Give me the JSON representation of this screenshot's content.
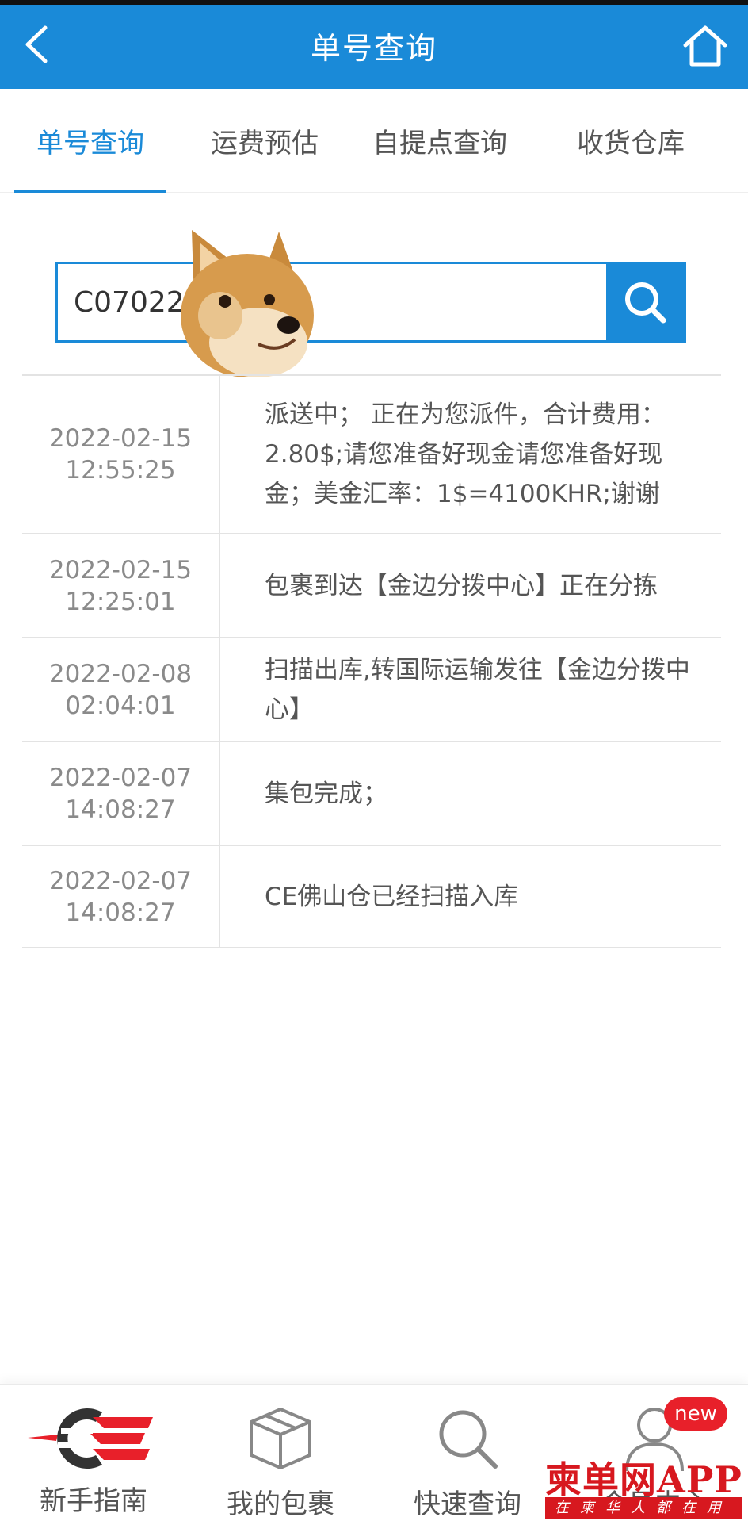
{
  "header": {
    "title": "单号查询"
  },
  "tabs": [
    {
      "label": "单号查询",
      "active": true
    },
    {
      "label": "运费预估",
      "active": false
    },
    {
      "label": "自提点查询",
      "active": false
    },
    {
      "label": "收货仓库",
      "active": false
    }
  ],
  "search": {
    "value": "C07022"
  },
  "timeline": [
    {
      "date": "2022-02-15",
      "time": "12:55:25",
      "text": "派送中； 正在为您派件，合计费用：2.80$;请您准备好现金请您准备好现金；美金汇率：1$=4100KHR;谢谢"
    },
    {
      "date": "2022-02-15",
      "time": "12:25:01",
      "text": "包裹到达【金边分拨中心】正在分拣"
    },
    {
      "date": "2022-02-08",
      "time": "02:04:01",
      "text": "扫描出库,转国际运输发往【金边分拨中心】"
    },
    {
      "date": "2022-02-07",
      "time": "14:08:27",
      "text": "集包完成；"
    },
    {
      "date": "2022-02-07",
      "time": "14:08:27",
      "text": "CE佛山仓已经扫描入库"
    }
  ],
  "bottom_nav": [
    {
      "label": "新手指南",
      "icon": "ce-logo-icon"
    },
    {
      "label": "我的包裹",
      "icon": "package-icon"
    },
    {
      "label": "快速查询",
      "icon": "search-icon"
    },
    {
      "label": "会员中心",
      "icon": "user-icon"
    }
  ],
  "badge": "new",
  "watermark": {
    "title": "柬单网APP",
    "subtitle": "在柬华人都在用"
  },
  "colors": {
    "primary": "#1a8ad8",
    "badge_red": "#e8202a"
  }
}
